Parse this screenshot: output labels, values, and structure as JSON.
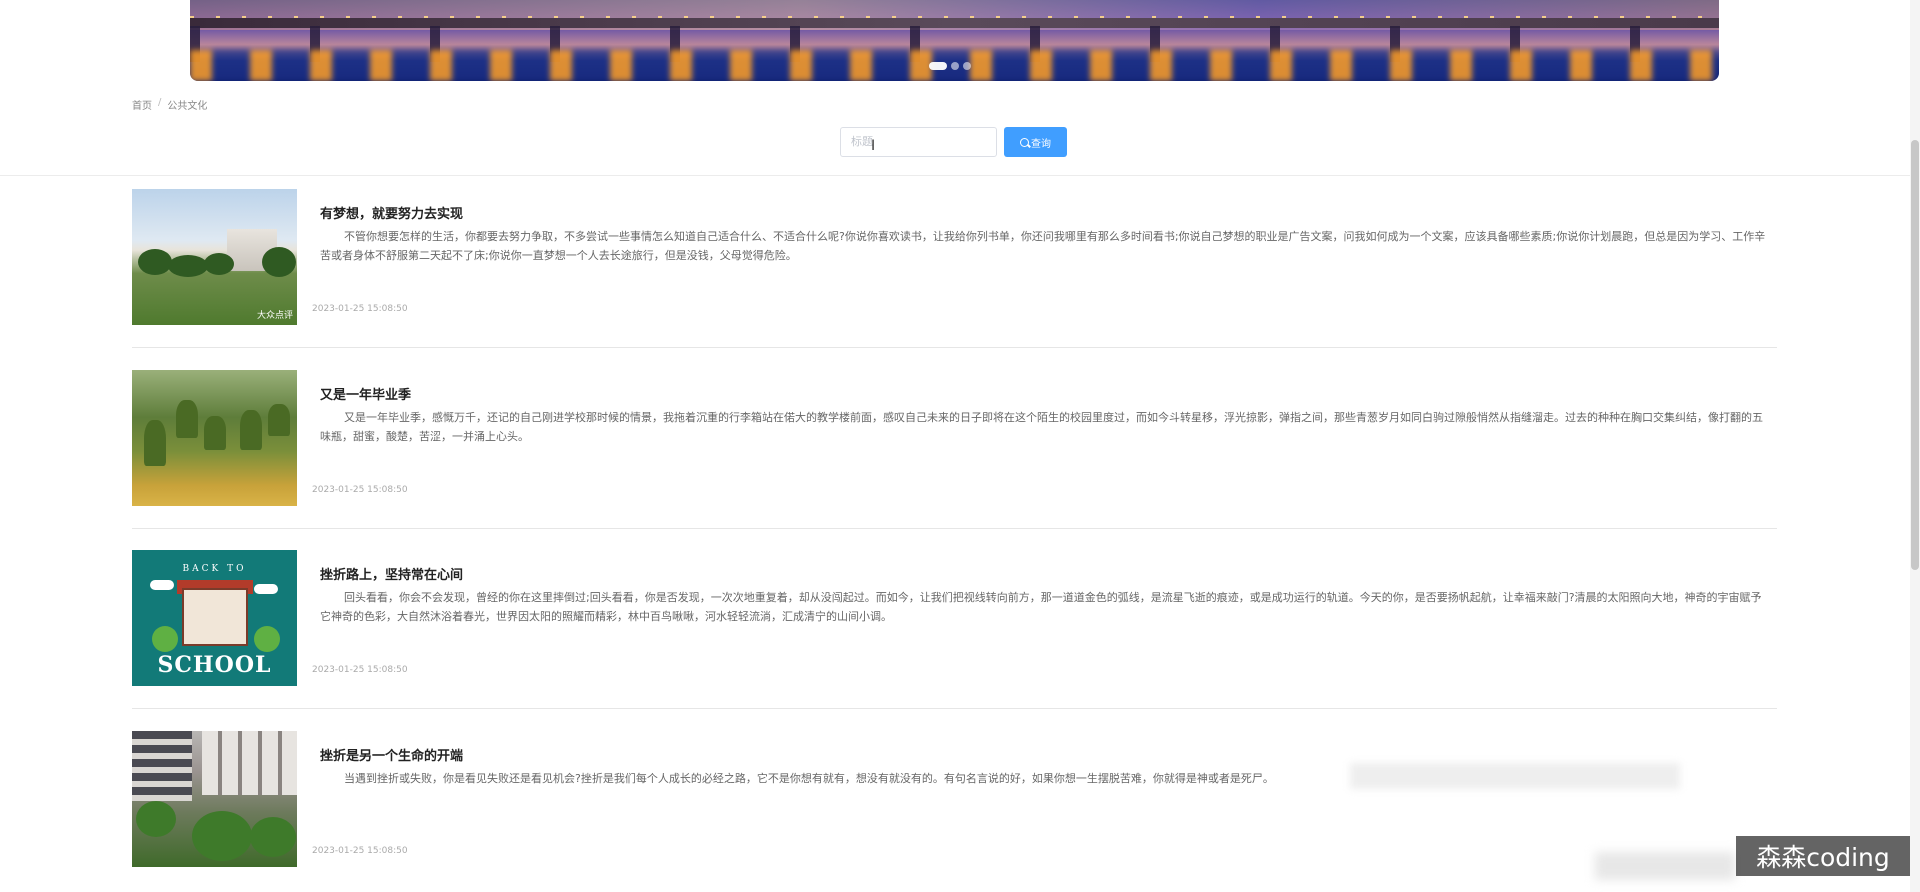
{
  "banner": {
    "dots": [
      {
        "active": true
      },
      {
        "active": false
      },
      {
        "active": false
      }
    ]
  },
  "breadcrumb": {
    "home": "首页",
    "separator": "/",
    "current": "公共文化"
  },
  "search": {
    "placeholder": "标题",
    "button_label": "查询"
  },
  "articles": [
    {
      "title": "有梦想，就要努力去实现",
      "description": "不管你想要怎样的生活，你都要去努力争取，不多尝试一些事情怎么知道自己适合什么、不适合什么呢?你说你喜欢读书，让我给你列书单，你还问我哪里有那么多时间看书;你说自己梦想的职业是广告文案，问我如何成为一个文案，应该具备哪些素质;你说你计划晨跑，但总是因为学习、工作辛苦或者身体不舒服第二天起不了床;你说你一直梦想一个人去长途旅行，但是没钱，父母觉得危险。",
      "date": "2023-01-25 15:08:50",
      "thumb_brand": "大众点评"
    },
    {
      "title": "又是一年毕业季",
      "description": "又是一年毕业季，感慨万千，还记的自己刚进学校那时候的情景，我拖着沉重的行李箱站在偌大的教学楼前面，感叹自己未来的日子即将在这个陌生的校园里度过，而如今斗转星移，浮光掠影，弹指之间，那些青葱岁月如同白驹过隙般悄然从指缝溜走。过去的种种在胸口交集纠结，像打翻的五味瓶，甜蜜，酸楚，苦涩，一并涌上心头。",
      "date": "2023-01-25 15:08:50"
    },
    {
      "title": "挫折路上，坚持常在心间",
      "description": "回头看看，你会不会发现，曾经的你在这里摔倒过;回头看看，你是否发现，一次次地重复着，却从没闯起过。而如今，让我们把视线转向前方，那一道道金色的弧线，是流星飞逝的痕迹，或是成功运行的轨道。今天的你，是否要扬帆起航，让幸福来敲门?清晨的太阳照向大地，神奇的宇宙赋予它神奇的色彩，大自然沐浴着春光，世界因太阳的照耀而精彩，林中百鸟啾啾，河水轻轻流淌，汇成清宁的山间小调。",
      "date": "2023-01-25 15:08:50",
      "thumb_top": "BACK TO",
      "thumb_bottom": "SCHOOL"
    },
    {
      "title": "挫折是另一个生命的开端",
      "description": "当遇到挫折或失败，你是看见失败还是看见机会?挫折是我们每个人成长的必经之路，它不是你想有就有，想没有就没有的。有句名言说的好，如果你想一生摆脱苦难，你就得是神或者是死尸。",
      "date": "2023-01-25 15:08:50"
    }
  ],
  "watermark": "森森coding",
  "colors": {
    "primary": "#409eff",
    "title": "#222222",
    "text": "#666666",
    "muted": "#aaaaaa"
  },
  "icons": {
    "search_button": "search-icon",
    "cursor": "text-cursor-icon"
  }
}
